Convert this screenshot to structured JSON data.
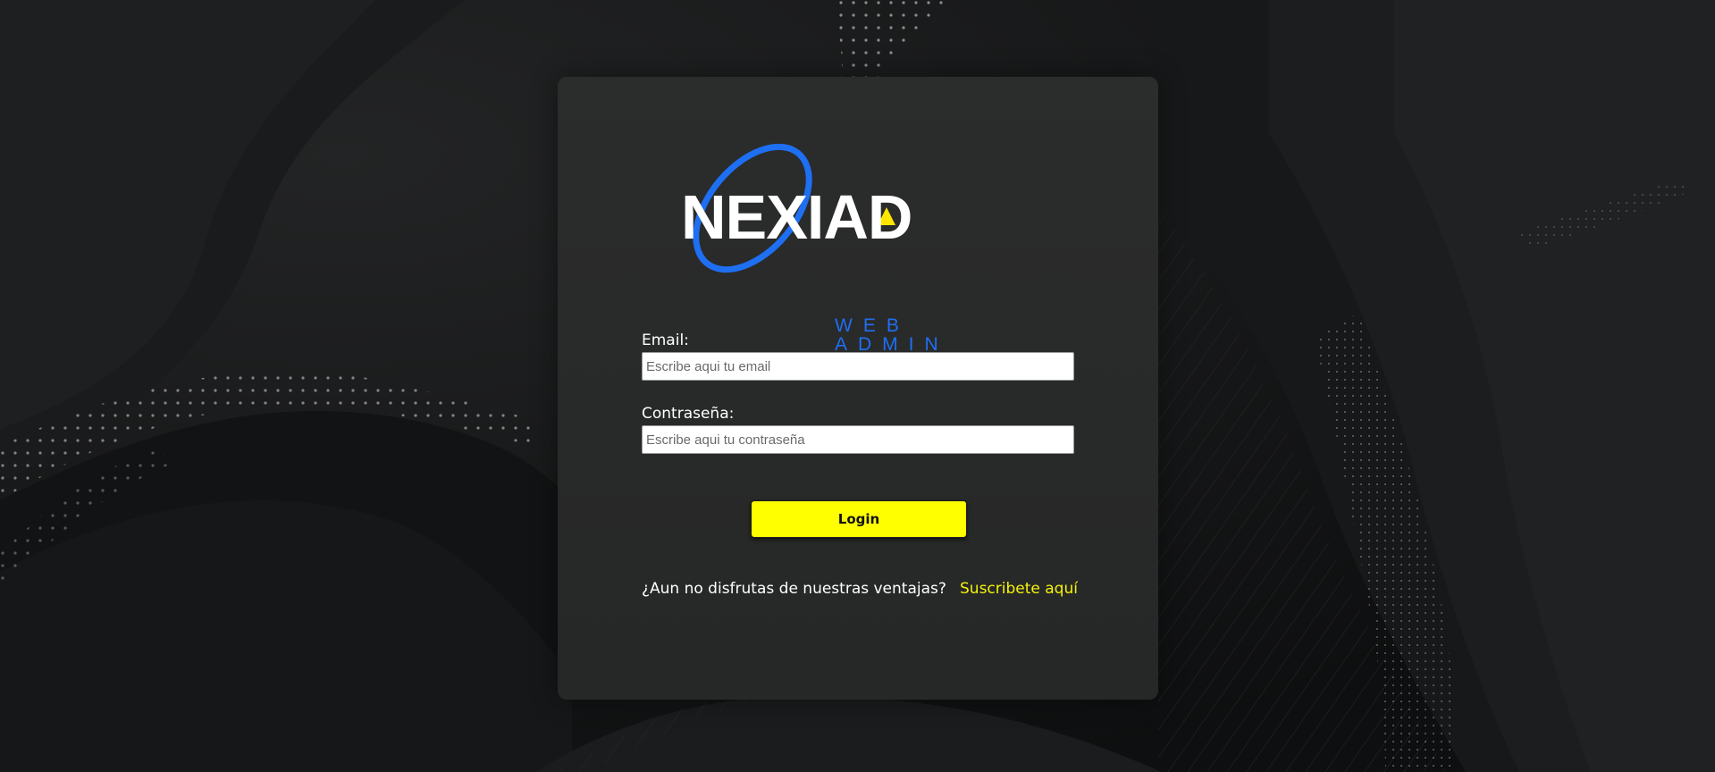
{
  "brand": {
    "logo_text": "NEXIAD",
    "logo_subtitle": "WEB ADMIN",
    "accent_blue": "#1e6ff2",
    "accent_yellow": "#ffff00"
  },
  "form": {
    "email_label": "Email:",
    "email_placeholder": "Escribe aqui tu email",
    "email_value": "",
    "password_label": "Contraseña:",
    "password_placeholder": "Escribe aqui tu contraseña",
    "password_value": "",
    "login_label": "Login"
  },
  "footer": {
    "promo_text": "¿Aun no disfrutas de nuestras ventajas?",
    "subscribe_link": "Suscribete aquí"
  }
}
